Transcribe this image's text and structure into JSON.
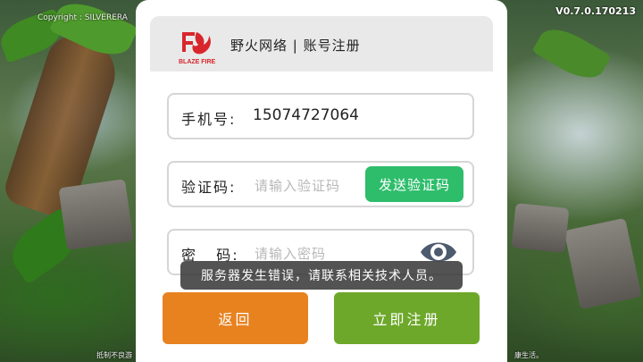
{
  "overlay": {
    "copyright": "Copyright : SILVERERA",
    "version": "V0.7.0.170213",
    "bottom_left_note": "抵制不良游",
    "bottom_right_note": "康生活。"
  },
  "dialog": {
    "logo_sub": "BLAZE FIRE",
    "header_title": "野火网络 | 账号注册",
    "phone": {
      "label": "手机号:",
      "value": "15074727064"
    },
    "code": {
      "label": "验证码:",
      "placeholder": "请输入验证码",
      "send_label": "发送验证码"
    },
    "password": {
      "label": "密   码:",
      "placeholder": "请输入密码"
    },
    "toast": "服务器发生错误，请联系相关技术人员。",
    "back_label": "返回",
    "register_label": "立即注册"
  },
  "colors": {
    "send_button": "#2ebd6b",
    "back_button": "#e8821f",
    "register_button": "#6da82a",
    "brand_red": "#d8262c"
  },
  "icons": {
    "logo": "blaze-fire-logo",
    "password_visibility": "eye-icon"
  }
}
